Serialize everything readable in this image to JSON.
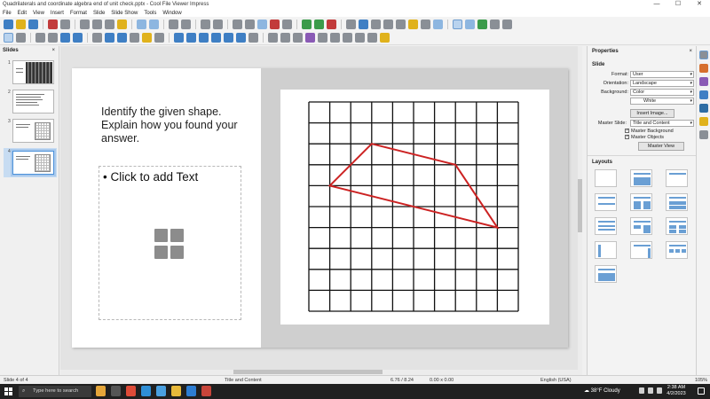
{
  "window": {
    "title": "Quadrilaterals and coordinate algebra end of unit check.pptx - Cool File Viewer Impress",
    "minimize": "—",
    "maximize": "☐",
    "close": "✕"
  },
  "menu": [
    "File",
    "Edit",
    "View",
    "Insert",
    "Format",
    "Slide",
    "Slide Show",
    "Tools",
    "Window"
  ],
  "slides_panel": {
    "title": "Slides",
    "close": "×",
    "numbers": [
      "1",
      "2",
      "3",
      "4"
    ],
    "selected": 4
  },
  "slide": {
    "question": "Identify the given shape. Explain how you found your answer.",
    "placeholder": "• Click to add Text",
    "grid": {
      "columns": 10,
      "rows": 10
    },
    "shape_vertices": [
      [
        3,
        2
      ],
      [
        7,
        3
      ],
      [
        9,
        6
      ],
      [
        1,
        4
      ]
    ],
    "shape_color": "#cc2222"
  },
  "properties": {
    "title": "Properties",
    "close": "×",
    "section_slide": "Slide",
    "format_label": "Format:",
    "format_value": "User",
    "orientation_label": "Orientation:",
    "orientation_value": "Landscape",
    "background_label": "Background:",
    "background_value": "Color",
    "background_color_value": "White",
    "insert_image": "Insert Image...",
    "master_slide_label": "Master Slide:",
    "master_slide_value": "Title and Content",
    "master_background": "Master Background",
    "master_objects": "Master Objects",
    "master_view": "Master View",
    "section_layouts": "Layouts"
  },
  "status": {
    "slide": "Slide 4 of 4",
    "layout": "Title and Content",
    "position": "6.76 / 8.24",
    "size": "0.00 x 0.00",
    "language": "English (USA)",
    "zoom": "105%"
  },
  "taskbar": {
    "search_placeholder": "Type here to search",
    "weather": "38°F  Cloudy",
    "time": "2:38 AM",
    "date": "4/2/2023"
  }
}
